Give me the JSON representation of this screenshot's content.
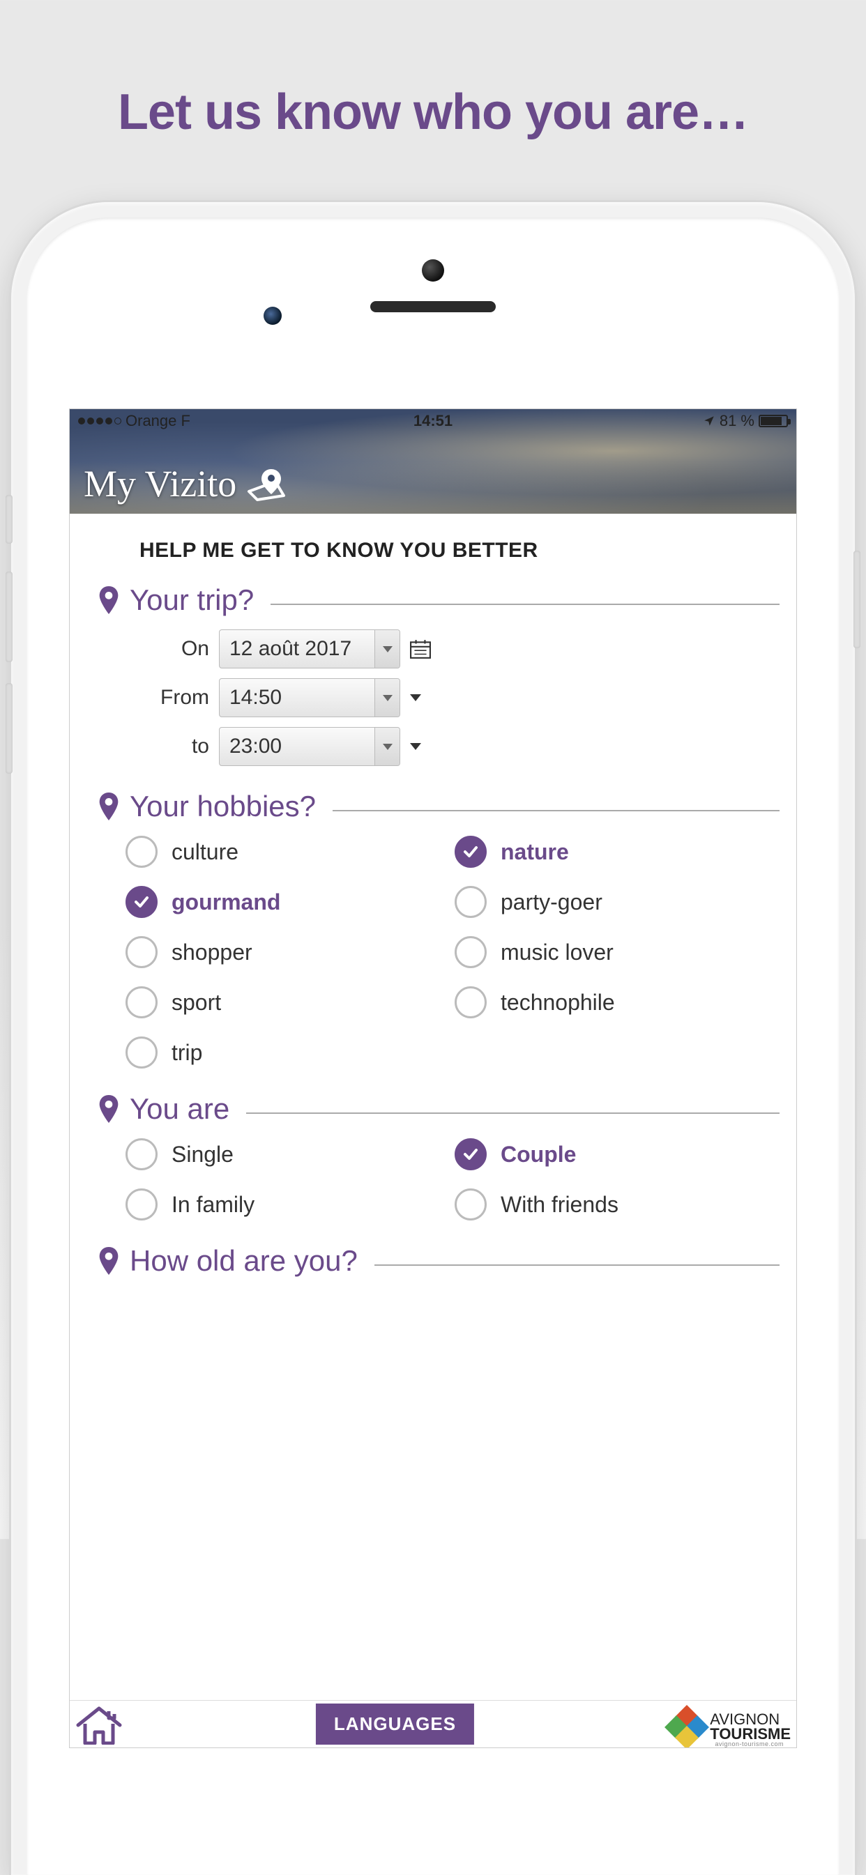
{
  "promo": {
    "heading": "Let us know who you are…"
  },
  "status_bar": {
    "carrier": "Orange F",
    "time": "14:51",
    "battery_label": "81 %"
  },
  "app": {
    "logo_text": "My Vizito"
  },
  "page": {
    "title": "HELP ME GET TO KNOW YOU BETTER"
  },
  "sections": {
    "trip": {
      "label": "Your trip?",
      "on_label": "On",
      "on_value": "12 août 2017",
      "from_label": "From",
      "from_value": "14:50",
      "to_label": "to",
      "to_value": "23:00"
    },
    "hobbies": {
      "label": "Your hobbies?",
      "options": [
        {
          "label": "culture",
          "selected": false
        },
        {
          "label": "nature",
          "selected": true
        },
        {
          "label": "gourmand",
          "selected": true
        },
        {
          "label": "party-goer",
          "selected": false
        },
        {
          "label": "shopper",
          "selected": false
        },
        {
          "label": "music lover",
          "selected": false
        },
        {
          "label": "sport",
          "selected": false
        },
        {
          "label": "technophile",
          "selected": false
        },
        {
          "label": "trip",
          "selected": false
        }
      ]
    },
    "youare": {
      "label": "You are",
      "options": [
        {
          "label": "Single",
          "selected": false
        },
        {
          "label": "Couple",
          "selected": true
        },
        {
          "label": "In family",
          "selected": false
        },
        {
          "label": "With friends",
          "selected": false
        }
      ]
    },
    "age": {
      "label": "How old are you?"
    }
  },
  "bottom_bar": {
    "languages_label": "LANGUAGES",
    "tourism_line1": "AVIGNON",
    "tourism_line2": "TOURISME",
    "tourism_sub": "avignon-tourisme.com"
  },
  "colors": {
    "accent": "#6a4a8a"
  }
}
